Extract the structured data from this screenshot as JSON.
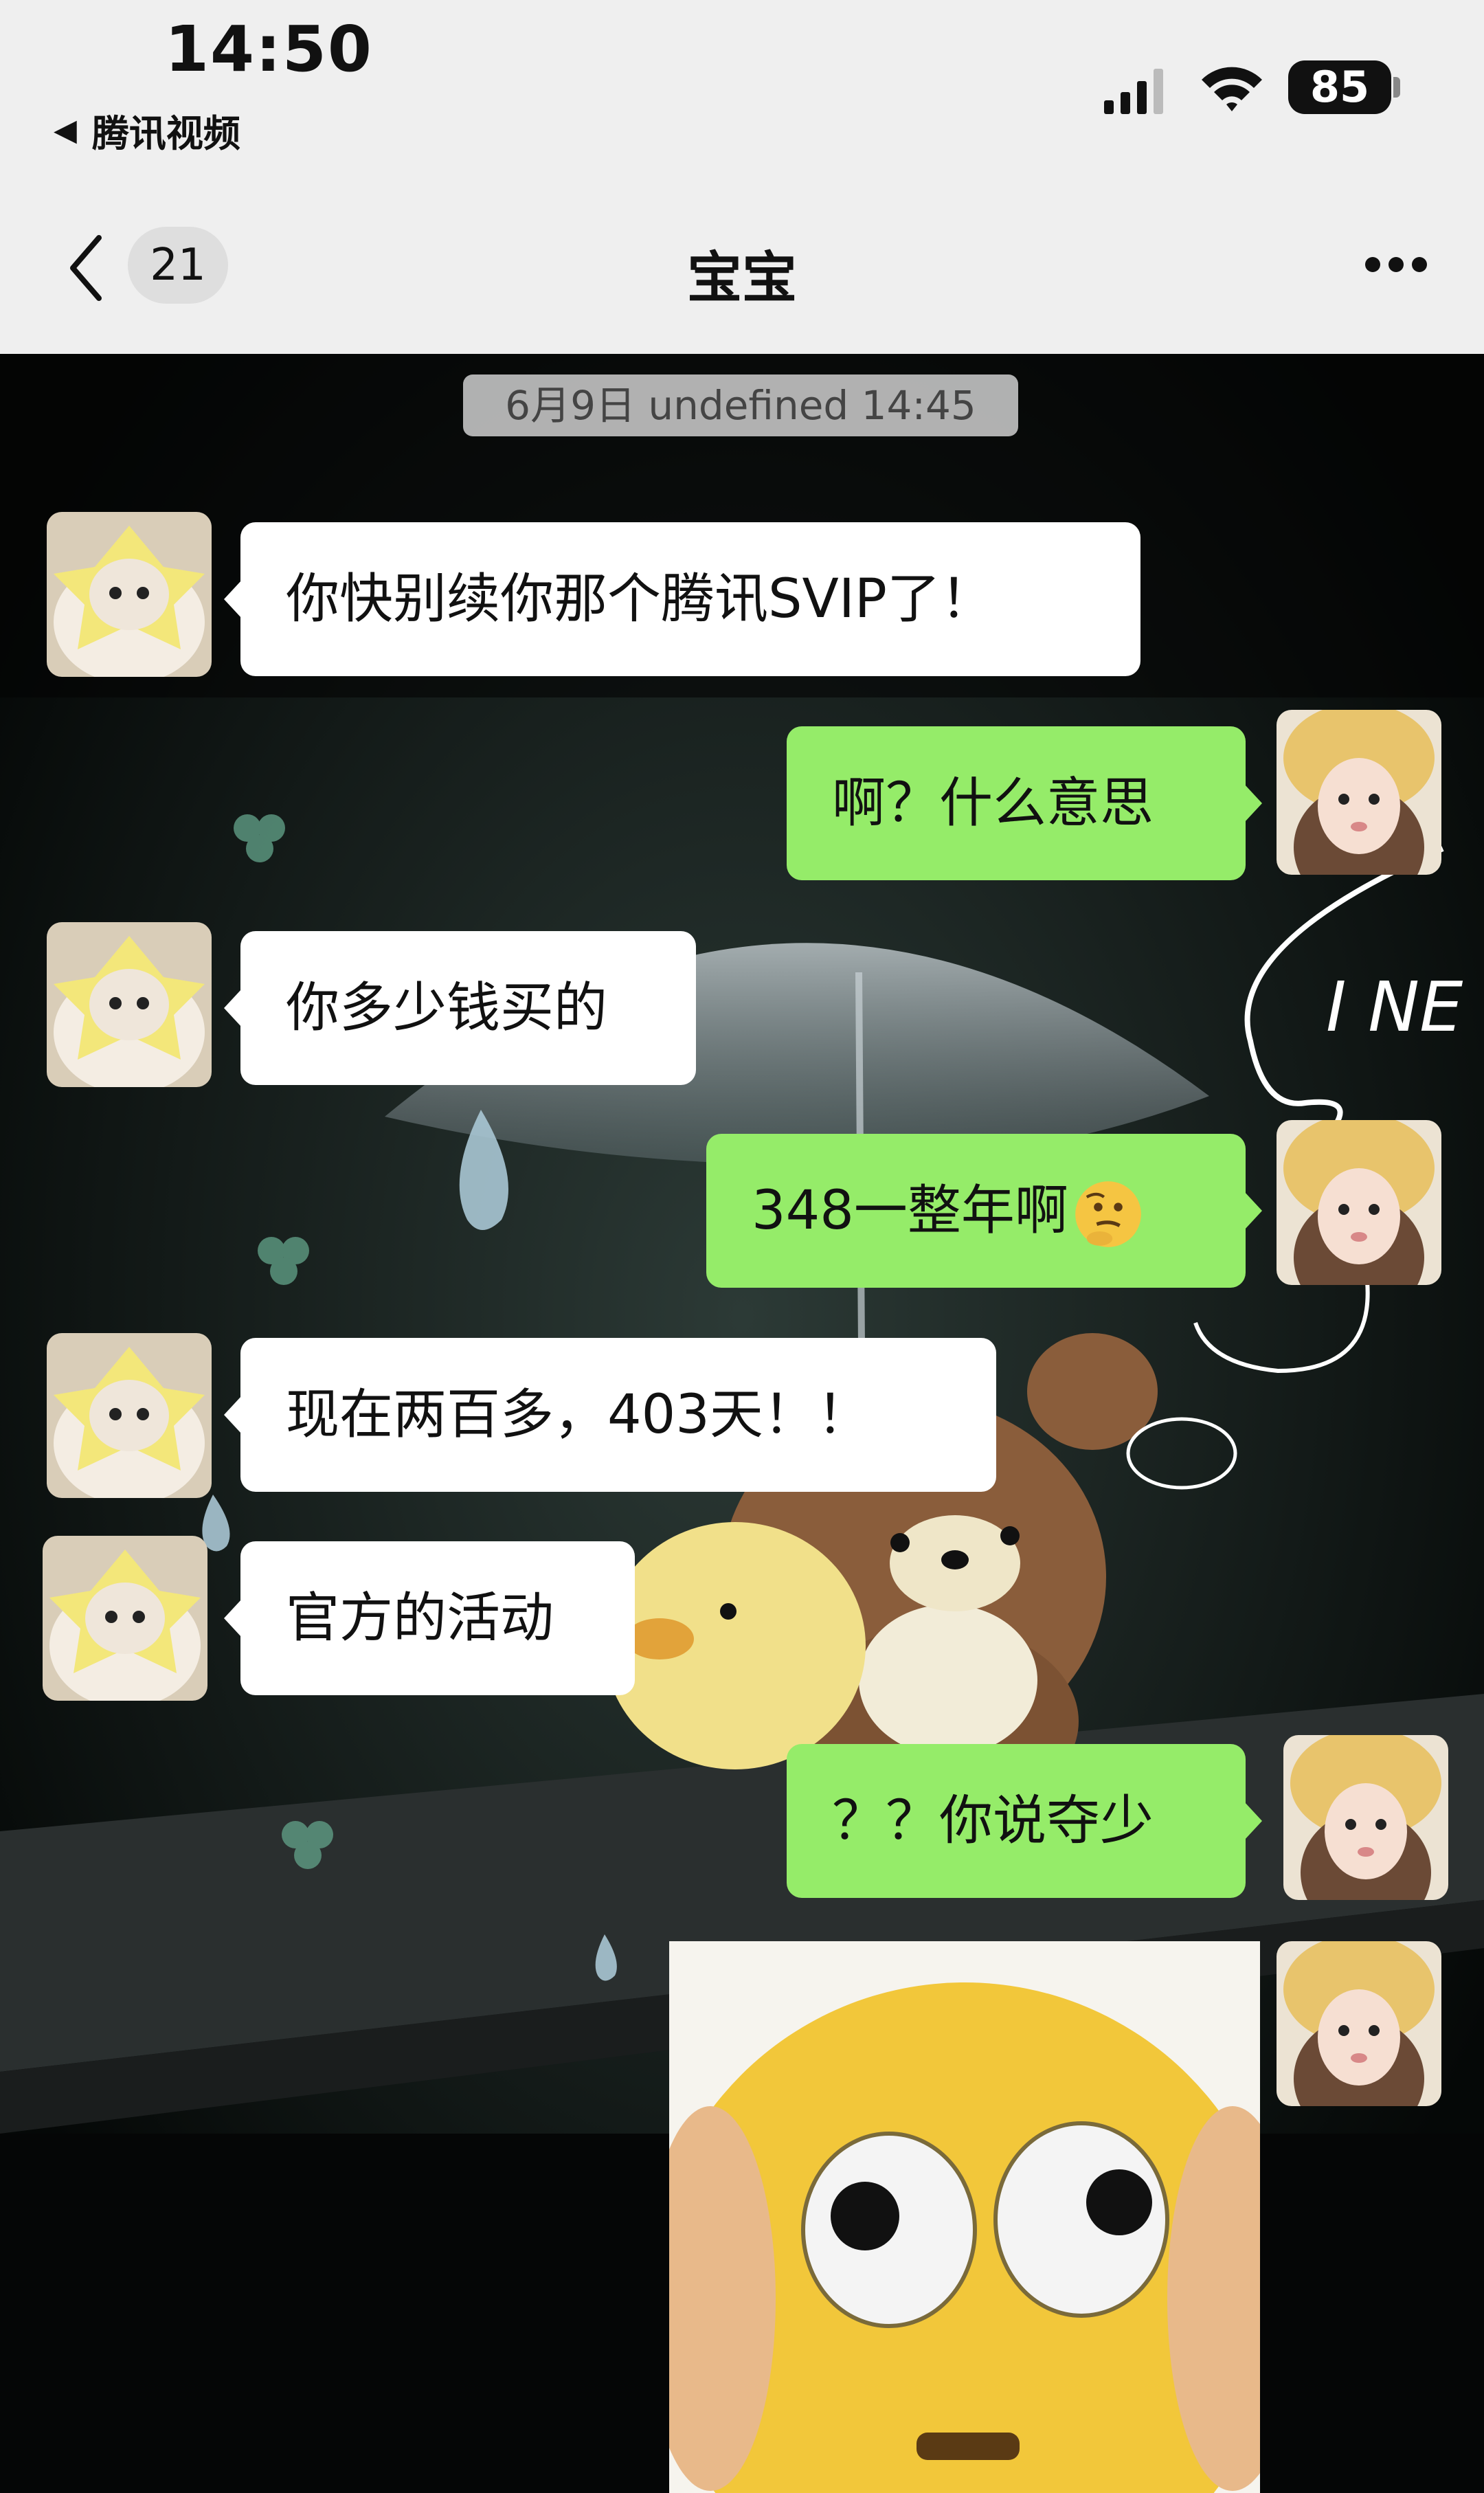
{
  "status_bar": {
    "time": "14:50",
    "back_app_label": "腾讯视频",
    "battery": "85",
    "icons": [
      "cellular-signal-icon",
      "wifi-icon",
      "battery-icon"
    ]
  },
  "nav": {
    "unread_count": "21",
    "title": "宝宝",
    "icons": [
      "chevron-left-icon",
      "more-icon"
    ]
  },
  "chat": {
    "timestamp": "6月9日 undefined 14:45",
    "messages": [
      {
        "side": "in",
        "text": "你快别续你那个腾讯SVIP了！"
      },
      {
        "side": "out",
        "text": "啊？什么意思"
      },
      {
        "side": "in",
        "text": "你多少钱买的"
      },
      {
        "side": "out",
        "text": "348一整年啊",
        "emoji": "thinking-face-icon"
      },
      {
        "side": "in",
        "text": "现在两百多，403天！！"
      },
      {
        "side": "in",
        "text": "官方的活动"
      },
      {
        "side": "out",
        "text": "？？你说夺少"
      },
      {
        "side": "out",
        "sticker": "shocked-face-sticker"
      }
    ]
  },
  "background": {
    "text": "I NE"
  },
  "colors": {
    "out_bubble": "#95ec69",
    "in_bubble": "#ffffff",
    "header_bg": "#efefef"
  }
}
